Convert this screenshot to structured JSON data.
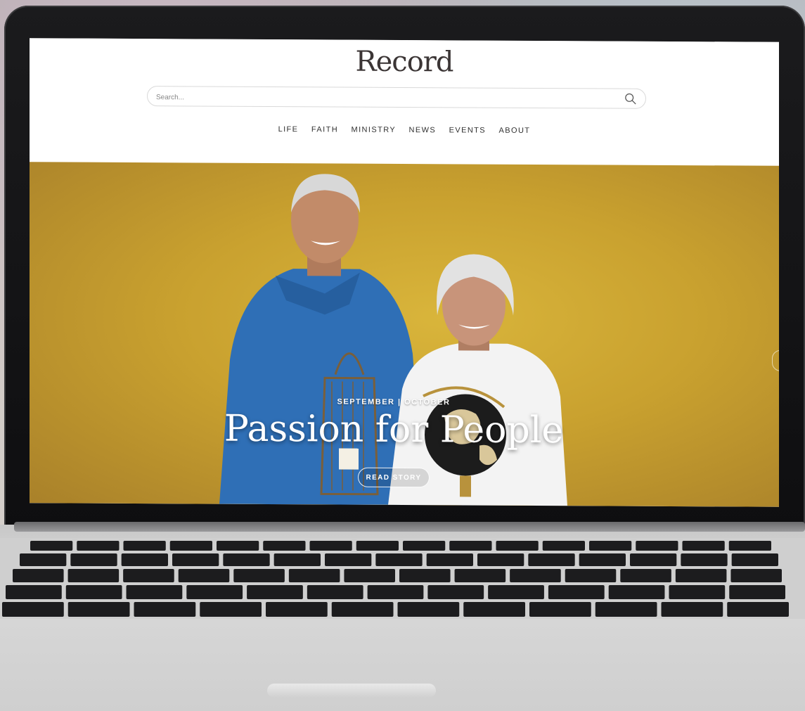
{
  "site": {
    "logo": "Record",
    "search": {
      "placeholder": "Search..."
    },
    "nav": {
      "items": [
        "LIFE",
        "FAITH",
        "MINISTRY",
        "NEWS",
        "EVENTS",
        "ABOUT"
      ]
    },
    "hero": {
      "kicker": "SEPTEMBER | OCTOBER",
      "title": "Passion for People",
      "cta_label": "READ STORY",
      "background_color": "#c9a12f"
    }
  },
  "icons": {
    "search": "search-icon",
    "slider_next": "chevron-right-icon",
    "laptop": "laptop-icon"
  }
}
